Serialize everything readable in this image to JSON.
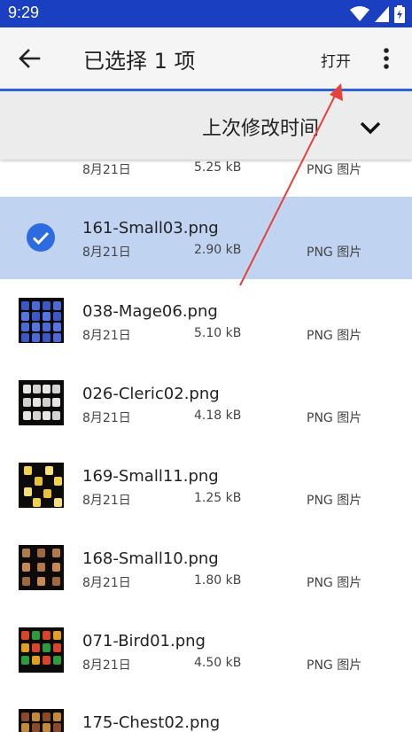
{
  "status_bar": {
    "time": "9:29",
    "icons": [
      "wifi-icon",
      "signal-icon",
      "battery-icon"
    ]
  },
  "app_bar": {
    "title": "已选择 1 项",
    "open_label": "打开",
    "back_icon": "arrow-left-icon",
    "more_icon": "more-vert-icon"
  },
  "sort_bar": {
    "label": "上次修改时间",
    "icon": "chevron-down-icon"
  },
  "files": [
    {
      "name": "",
      "date": "8月21日",
      "size": "5.25 kB",
      "type": "PNG 图片",
      "selected": false
    },
    {
      "name": "161-Small03.png",
      "date": "8月21日",
      "size": "2.90 kB",
      "type": "PNG 图片",
      "selected": true
    },
    {
      "name": "038-Mage06.png",
      "date": "8月21日",
      "size": "5.10 kB",
      "type": "PNG 图片",
      "selected": false
    },
    {
      "name": "026-Cleric02.png",
      "date": "8月21日",
      "size": "4.18 kB",
      "type": "PNG 图片",
      "selected": false
    },
    {
      "name": "169-Small11.png",
      "date": "8月21日",
      "size": "1.25 kB",
      "type": "PNG 图片",
      "selected": false
    },
    {
      "name": "168-Small10.png",
      "date": "8月21日",
      "size": "1.80 kB",
      "type": "PNG 图片",
      "selected": false
    },
    {
      "name": "071-Bird01.png",
      "date": "8月21日",
      "size": "4.50 kB",
      "type": "PNG 图片",
      "selected": false
    },
    {
      "name": "175-Chest02.png",
      "date": "",
      "size": "",
      "type": "",
      "selected": false
    }
  ],
  "colors": {
    "status_bar": "#1a3fc1",
    "accent": "#2d62d8",
    "selected_row": "#c0d3f1",
    "annotation_arrow": "#e8403a"
  }
}
